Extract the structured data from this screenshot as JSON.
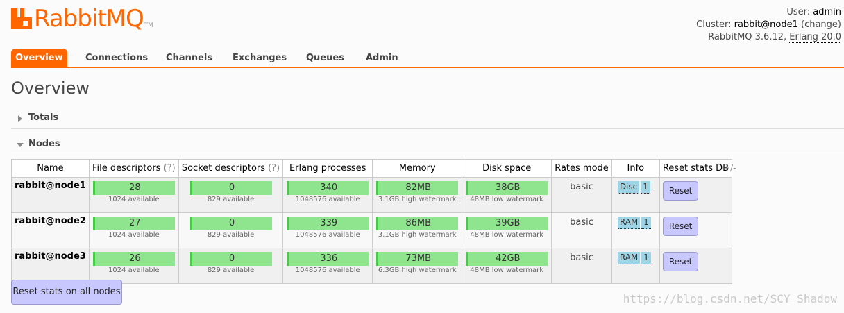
{
  "brand": {
    "name": "RabbitMQ",
    "tm": "TM"
  },
  "status": {
    "user_label": "User:",
    "user": "admin",
    "cluster_label": "Cluster:",
    "cluster": "rabbit@node1",
    "change_link": "change",
    "version": "RabbitMQ 3.6.12,",
    "erlang": "Erlang 20.0"
  },
  "tabs": [
    {
      "label": "Overview",
      "active": true
    },
    {
      "label": "Connections"
    },
    {
      "label": "Channels"
    },
    {
      "label": "Exchanges"
    },
    {
      "label": "Queues"
    },
    {
      "label": "Admin"
    }
  ],
  "page_title": "Overview",
  "sections": {
    "totals": "Totals",
    "nodes": "Nodes"
  },
  "table": {
    "headers": {
      "name": "Name",
      "fd": "File descriptors",
      "sd": "Socket descriptors",
      "help": "(?)",
      "erlang": "Erlang processes",
      "memory": "Memory",
      "disk": "Disk space",
      "rates": "Rates mode",
      "info": "Info",
      "reset": "Reset stats DB"
    },
    "plusminus": "+/-",
    "rows": [
      {
        "name": "rabbit@node1",
        "fd": "28",
        "fd_sub": "1024 available",
        "sd": "0",
        "sd_sub": "829 available",
        "erl": "340",
        "erl_sub": "1048576 available",
        "mem": "82MB",
        "mem_sub": "3.1GB high watermark",
        "disk": "38GB",
        "disk_sub": "48MB low watermark",
        "rates": "basic",
        "type": "Disc",
        "count": "1",
        "reset": "Reset"
      },
      {
        "name": "rabbit@node2",
        "fd": "27",
        "fd_sub": "1024 available",
        "sd": "0",
        "sd_sub": "829 available",
        "erl": "339",
        "erl_sub": "1048576 available",
        "mem": "86MB",
        "mem_sub": "3.1GB high watermark",
        "disk": "39GB",
        "disk_sub": "48MB low watermark",
        "rates": "basic",
        "type": "RAM",
        "count": "1",
        "reset": "Reset"
      },
      {
        "name": "rabbit@node3",
        "fd": "26",
        "fd_sub": "1024 available",
        "sd": "0",
        "sd_sub": "829 available",
        "erl": "336",
        "erl_sub": "1048576 available",
        "mem": "73MB",
        "mem_sub": "6.3GB high watermark",
        "disk": "42GB",
        "disk_sub": "48MB low watermark",
        "rates": "basic",
        "type": "RAM",
        "count": "1",
        "reset": "Reset"
      }
    ]
  },
  "reset_all": "Reset stats on all nodes",
  "watermark": "https://blog.csdn.net/SCY_Shadow",
  "colors": {
    "accent": "#ff6600",
    "bar": "#8ee58e",
    "button": "#c8c8ff",
    "badge": "#9dd5e6"
  }
}
